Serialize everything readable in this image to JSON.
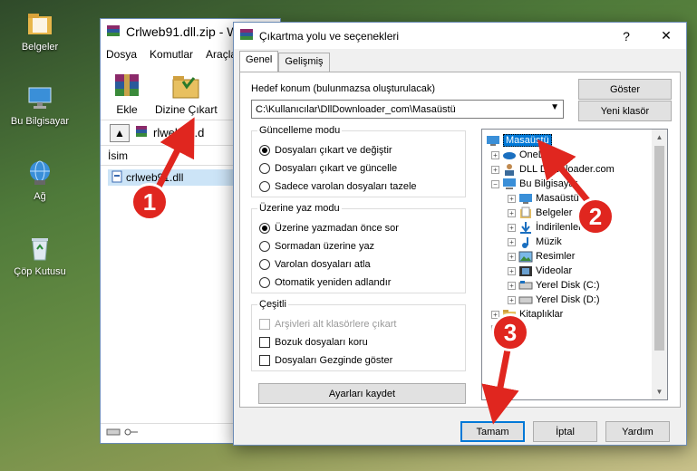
{
  "desktop": {
    "icons": [
      {
        "label": "Belgeler",
        "icon": "folder-icon"
      },
      {
        "label": "Bu Bilgisayar",
        "icon": "computer-icon"
      },
      {
        "label": "Ağ",
        "icon": "network-icon"
      },
      {
        "label": "Çöp Kutusu",
        "icon": "recycle-bin-icon"
      }
    ]
  },
  "background_window": {
    "title": "Crlweb91.dll.zip - W",
    "menu": [
      "Dosya",
      "Komutlar",
      "Araçla"
    ],
    "toolbar": {
      "add_label": "Ekle",
      "extract_label": "Dizine Çıkart"
    },
    "path": "rlweb91.d",
    "list_header": "İsim",
    "file_name": "crlweb91.dll"
  },
  "dialog": {
    "title": "Çıkartma yolu ve seçenekleri",
    "tabs": [
      "Genel",
      "Gelişmiş"
    ],
    "destination_label": "Hedef konum (bulunmazsa oluşturulacak)",
    "destination_value": "C:\\Kullanıcılar\\DllDownloader_com\\Masaüstü",
    "show_button": "Göster",
    "new_folder_button": "Yeni klasör",
    "update_mode": {
      "title": "Güncelleme modu",
      "options": [
        "Dosyaları çıkart ve değiştir",
        "Dosyaları çıkart ve güncelle",
        "Sadece varolan dosyaları tazele"
      ],
      "selected": 0
    },
    "overwrite_mode": {
      "title": "Üzerine yaz modu",
      "options": [
        "Üzerine yazmadan önce sor",
        "Sormadan üzerine yaz",
        "Varolan dosyaları atla",
        "Otomatik yeniden adlandır"
      ],
      "selected": 0
    },
    "misc": {
      "title": "Çeşitli",
      "options": [
        {
          "label": "Arşivleri alt klasörlere çıkart",
          "checked": false,
          "disabled": true
        },
        {
          "label": "Bozuk dosyaları koru",
          "checked": false,
          "disabled": false
        },
        {
          "label": "Dosyaları Gezginde göster",
          "checked": false,
          "disabled": false
        }
      ]
    },
    "save_settings_button": "Ayarları kaydet",
    "tree": [
      {
        "label": "Masaüstü",
        "level": 0,
        "icon": "desktop-icon",
        "expander": "",
        "selected": true
      },
      {
        "label": "OneDrive",
        "level": 1,
        "icon": "cloud-icon",
        "expander": "+"
      },
      {
        "label": "DLL Downloader.com",
        "level": 1,
        "icon": "user-icon",
        "expander": "+"
      },
      {
        "label": "Bu Bilgisayar",
        "level": 1,
        "icon": "computer-icon",
        "expander": "−"
      },
      {
        "label": "Masaüstü",
        "level": 2,
        "icon": "desktop-icon",
        "expander": "+"
      },
      {
        "label": "Belgeler",
        "level": 2,
        "icon": "documents-icon",
        "expander": "+"
      },
      {
        "label": "İndirilenler",
        "level": 2,
        "icon": "downloads-icon",
        "expander": "+"
      },
      {
        "label": "Müzik",
        "level": 2,
        "icon": "music-icon",
        "expander": "+"
      },
      {
        "label": "Resimler",
        "level": 2,
        "icon": "pictures-icon",
        "expander": "+"
      },
      {
        "label": "Videolar",
        "level": 2,
        "icon": "videos-icon",
        "expander": "+"
      },
      {
        "label": "Yerel Disk (C:)",
        "level": 2,
        "icon": "disk-icon",
        "expander": "+"
      },
      {
        "label": "Yerel Disk (D:)",
        "level": 2,
        "icon": "disk-icon",
        "expander": "+"
      },
      {
        "label": "Kitaplıklar",
        "level": 1,
        "icon": "library-icon",
        "expander": "+"
      },
      {
        "label": "",
        "level": 1,
        "icon": "network-icon",
        "expander": "+"
      }
    ],
    "ok_button": "Tamam",
    "cancel_button": "İptal",
    "help_button": "Yardım"
  },
  "annotations": {
    "steps": [
      "1",
      "2",
      "3"
    ],
    "color": "#e0261f"
  }
}
